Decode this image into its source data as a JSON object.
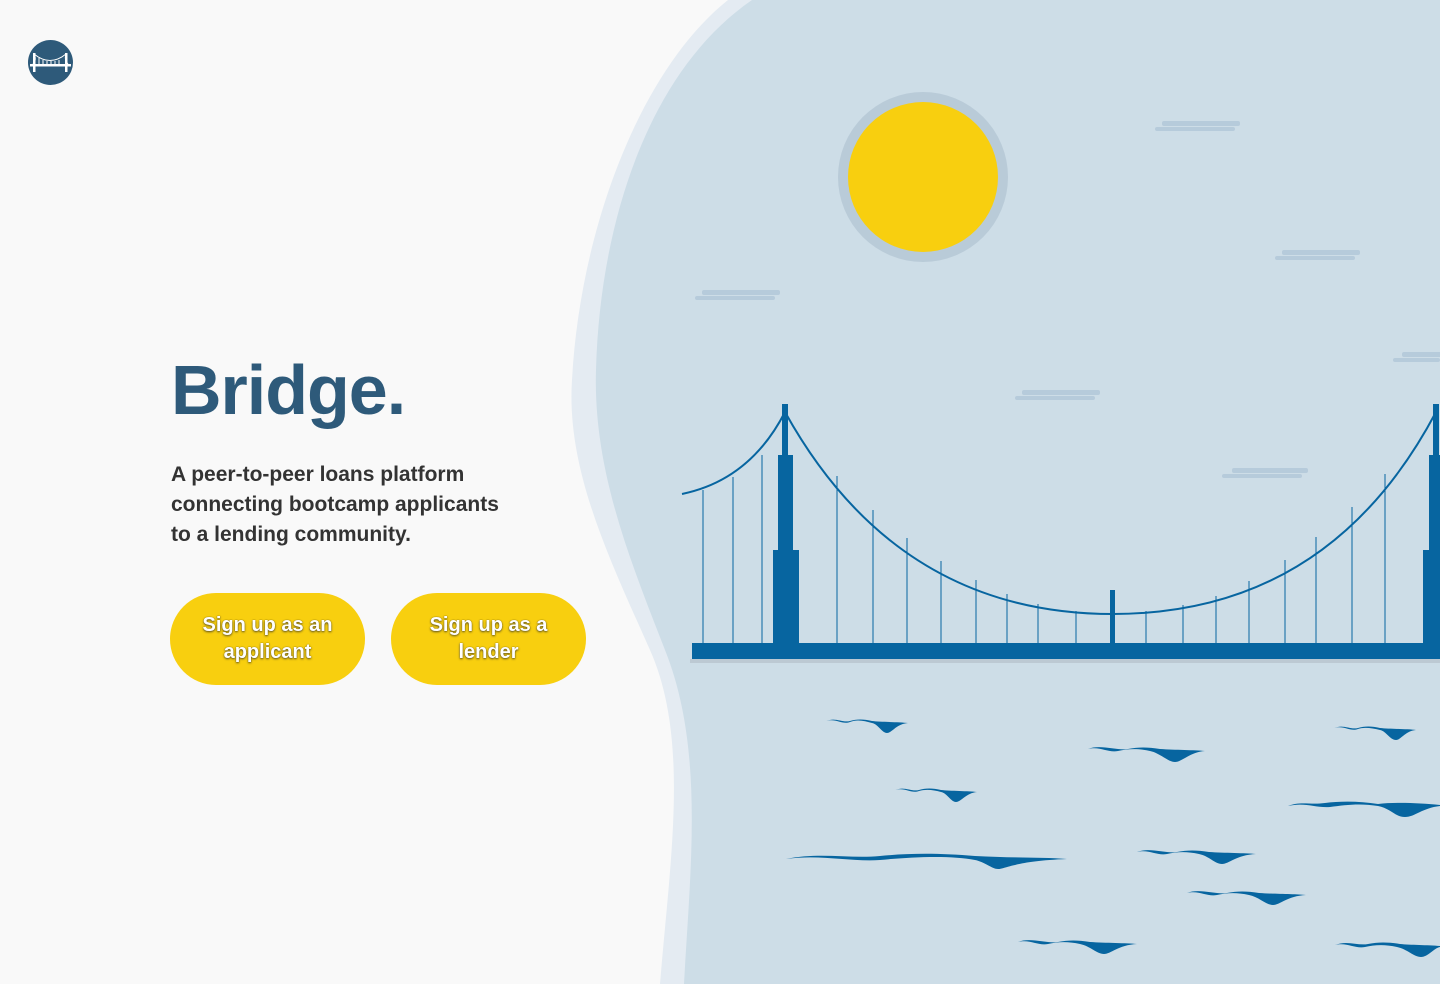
{
  "brand": {
    "title": "Bridge."
  },
  "hero": {
    "tagline": "A peer-to-peer loans platform connecting bootcamp applicants to a lending community."
  },
  "actions": {
    "applicant_label": "Sign up as an applicant",
    "lender_label": "Sign up as a lender"
  },
  "colors": {
    "brand_blue": "#2e5a7a",
    "accent_yellow": "#f8cf0f",
    "sky": "#cddde7",
    "bridge": "#0765a0",
    "background": "#f9f9f9"
  },
  "icons": {
    "logo": "bridge-logo-icon"
  }
}
